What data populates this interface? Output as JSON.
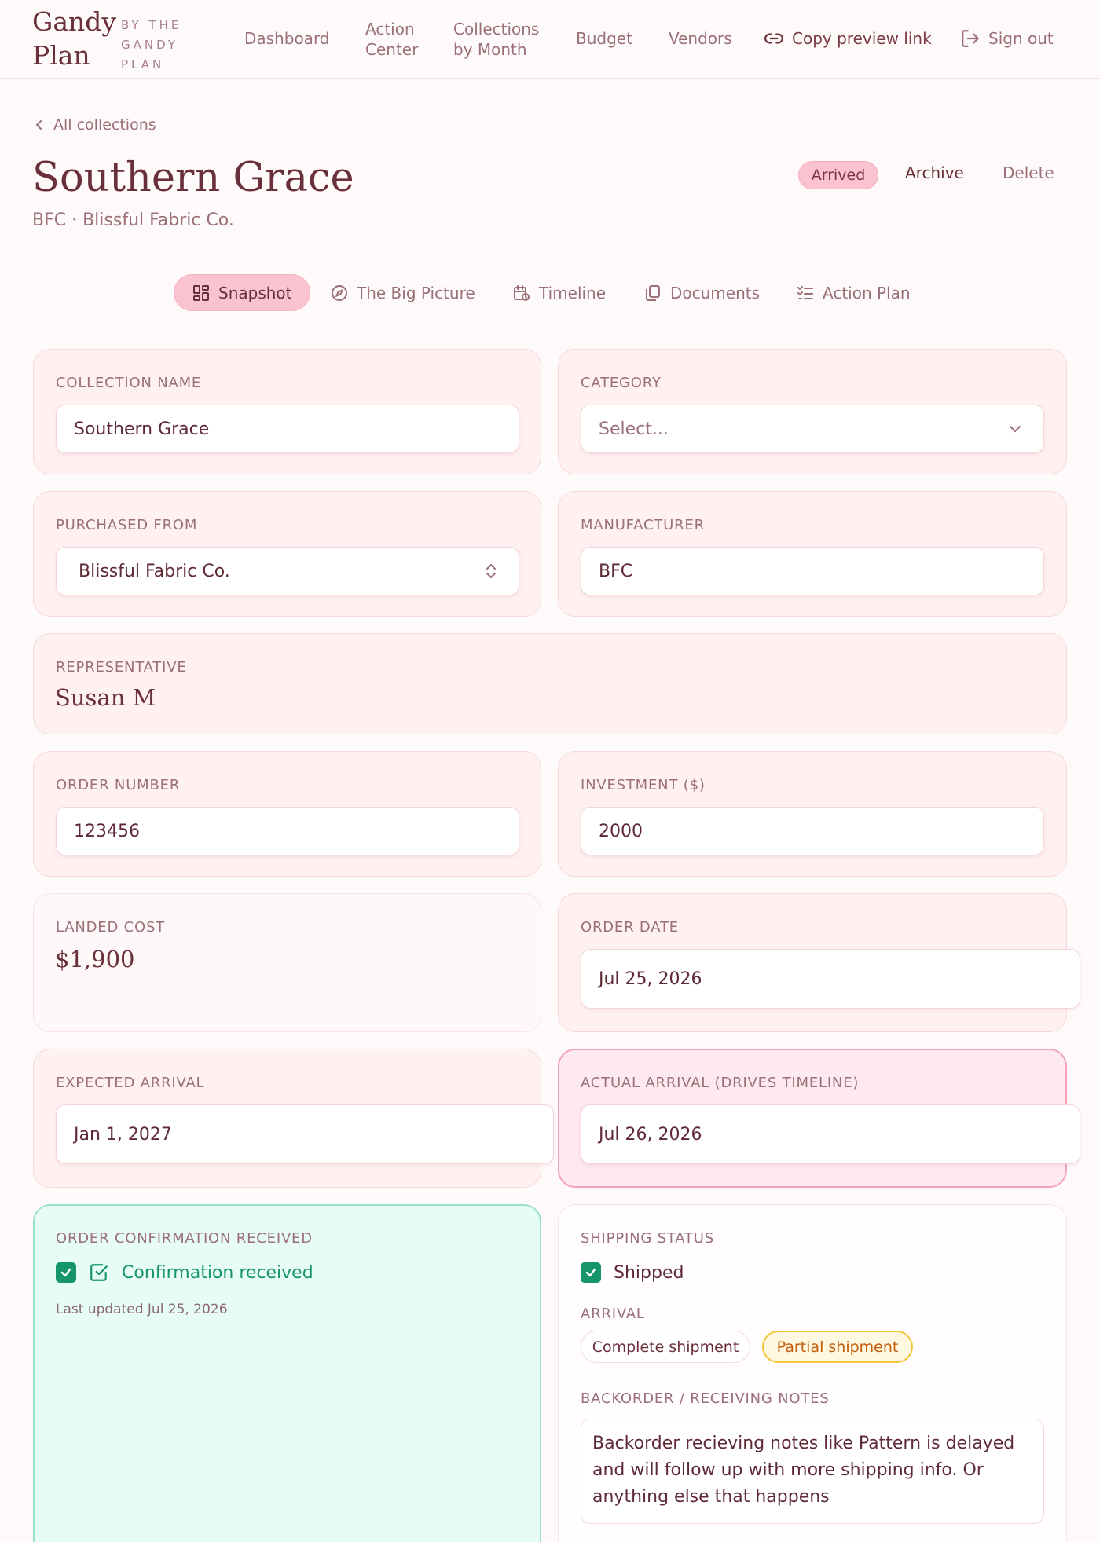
{
  "header": {
    "logo_name_1": "Gandy",
    "logo_name_2": "Plan",
    "logo_by_1": "BY THE",
    "logo_by_2": "GANDY",
    "logo_by_3": "PLAN",
    "nav": {
      "dashboard": "Dashboard",
      "action_center_1": "Action",
      "action_center_2": "Center",
      "collections_1": "Collections",
      "collections_2": "by Month",
      "budget": "Budget",
      "vendors": "Vendors",
      "copy_link": "Copy preview link",
      "sign_out": "Sign out"
    }
  },
  "page": {
    "back_label": "All collections",
    "title": "Southern Grace",
    "subtitle": "BFC · Blissful Fabric Co.",
    "status": "Arrived",
    "archive_label": "Archive",
    "delete_label": "Delete"
  },
  "tabs": {
    "snapshot": "Snapshot",
    "big_picture": "The Big Picture",
    "timeline": "Timeline",
    "documents": "Documents",
    "action_plan": "Action Plan"
  },
  "form": {
    "collection_name": {
      "label": "COLLECTION NAME",
      "value": "Southern Grace"
    },
    "category": {
      "label": "CATEGORY",
      "placeholder": "Select..."
    },
    "purchased_from": {
      "label": "PURCHASED FROM",
      "value": "Blissful Fabric Co."
    },
    "manufacturer": {
      "label": "MANUFACTURER",
      "value": "BFC"
    },
    "representative": {
      "label": "REPRESENTATIVE",
      "value": "Susan M"
    },
    "order_number": {
      "label": "ORDER NUMBER",
      "value": "123456"
    },
    "investment": {
      "label": "INVESTMENT ($)",
      "value": "2000"
    },
    "landed_cost": {
      "label": "LANDED COST",
      "value": "$1,900"
    },
    "order_date": {
      "label": "ORDER DATE",
      "value": "Jul 25, 2026"
    },
    "expected_arrival": {
      "label": "EXPECTED ARRIVAL",
      "value": "Jan 1, 2027"
    },
    "actual_arrival": {
      "label": "ACTUAL ARRIVAL (DRIVES TIMELINE)",
      "value": "Jul 26, 2026"
    },
    "order_confirmation": {
      "label": "ORDER CONFIRMATION RECEIVED",
      "status_text": "Confirmation received",
      "updated": "Last updated Jul 25, 2026",
      "checked": true
    },
    "shipping": {
      "label": "SHIPPING STATUS",
      "shipped_label": "Shipped",
      "checked": true,
      "arrival_label": "ARRIVAL",
      "complete_label": "Complete shipment",
      "partial_label": "Partial shipment",
      "notes_label": "BACKORDER / RECEIVING NOTES",
      "notes_line_1": "Backorder recieving notes like Pattern is delayed",
      "notes_line_2": "and will follow up with more shipping info. Or",
      "notes_line_3": "anything else that happens"
    }
  },
  "colors": {
    "accent_pink": "#fbc3d2",
    "text_primary": "#6a2f3c",
    "success_green": "#17956a",
    "partial_orange": "#c25a06"
  }
}
